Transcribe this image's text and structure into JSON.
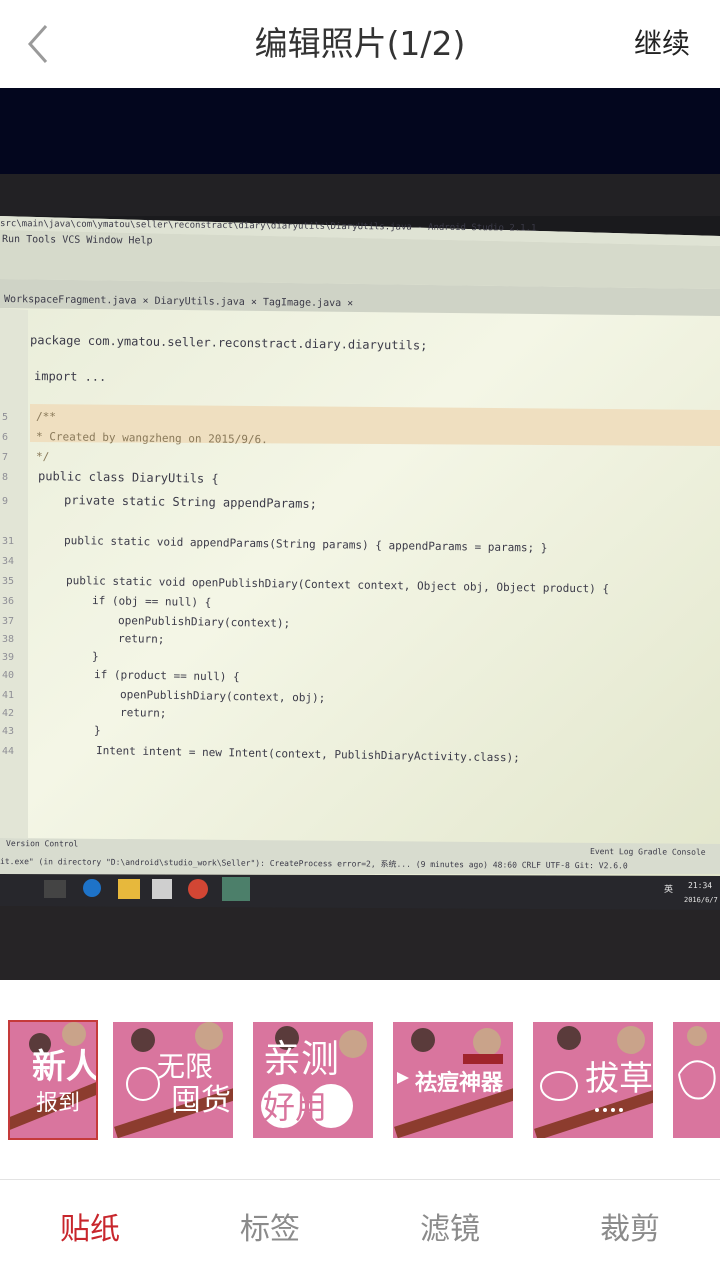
{
  "header": {
    "title": "编辑照片(1/2)",
    "continue_label": "继续"
  },
  "photo": {
    "screen_texts": [
      "src\\main\\java\\com\\ymatou\\seller\\reconstract\\diary\\diaryutils\\DiaryUtils.java - Android Studio 2.1.1",
      "Run  Tools  VCS  Window  Help",
      "WorkspaceFragment.java ×   DiaryUtils.java ×   TagImage.java ×",
      "package com.ymatou.seller.reconstract.diary.diaryutils;",
      "import ...",
      "/**",
      " * Created by wangzheng on 2015/9/6.",
      " */",
      "public class DiaryUtils {",
      "    private static String appendParams;",
      "    public static void appendParams(String params) { appendParams = params; }",
      "    public static void openPublishDiary(Context context, Object obj, Object product) {",
      "        if (obj == null) {",
      "            openPublishDiary(context);",
      "            return;",
      "        }",
      "        if (product == null) {",
      "            openPublishDiary(context, obj);",
      "            return;",
      "        }",
      "        Intent intent = new Intent(context, PublishDiaryActivity.class);",
      "Version Control",
      "Event Log   Gradle Console",
      "it.exe\" (in directory \"D:\\android\\studio_work\\Seller\"): CreateProcess error=2, 系统... (9 minutes ago)  48:60  CRLF  UTF-8  Git: V2.6.0",
      "21:34",
      "2016/6/7",
      "英"
    ],
    "line_numbers": [
      "5",
      "6",
      "7",
      "8",
      "9",
      "31",
      "34",
      "35",
      "36",
      "37",
      "38",
      "39",
      "40",
      "41",
      "42",
      "43",
      "44"
    ]
  },
  "stickers": [
    {
      "text1": "新人",
      "text2": "报到"
    },
    {
      "text1": "无限",
      "text2": "囤货"
    },
    {
      "text1": "亲测",
      "text2": "好用"
    },
    {
      "text1": "祛痘神器",
      "text2": ""
    },
    {
      "text1": "拔草",
      "text2": ""
    }
  ],
  "tabs": [
    {
      "label": "贴纸",
      "active": true
    },
    {
      "label": "标签",
      "active": false
    },
    {
      "label": "滤镜",
      "active": false
    },
    {
      "label": "裁剪",
      "active": false
    }
  ],
  "colors": {
    "accent": "#c8262c",
    "photo_background": "#03061e",
    "sticker_pink": "#d9759e"
  }
}
